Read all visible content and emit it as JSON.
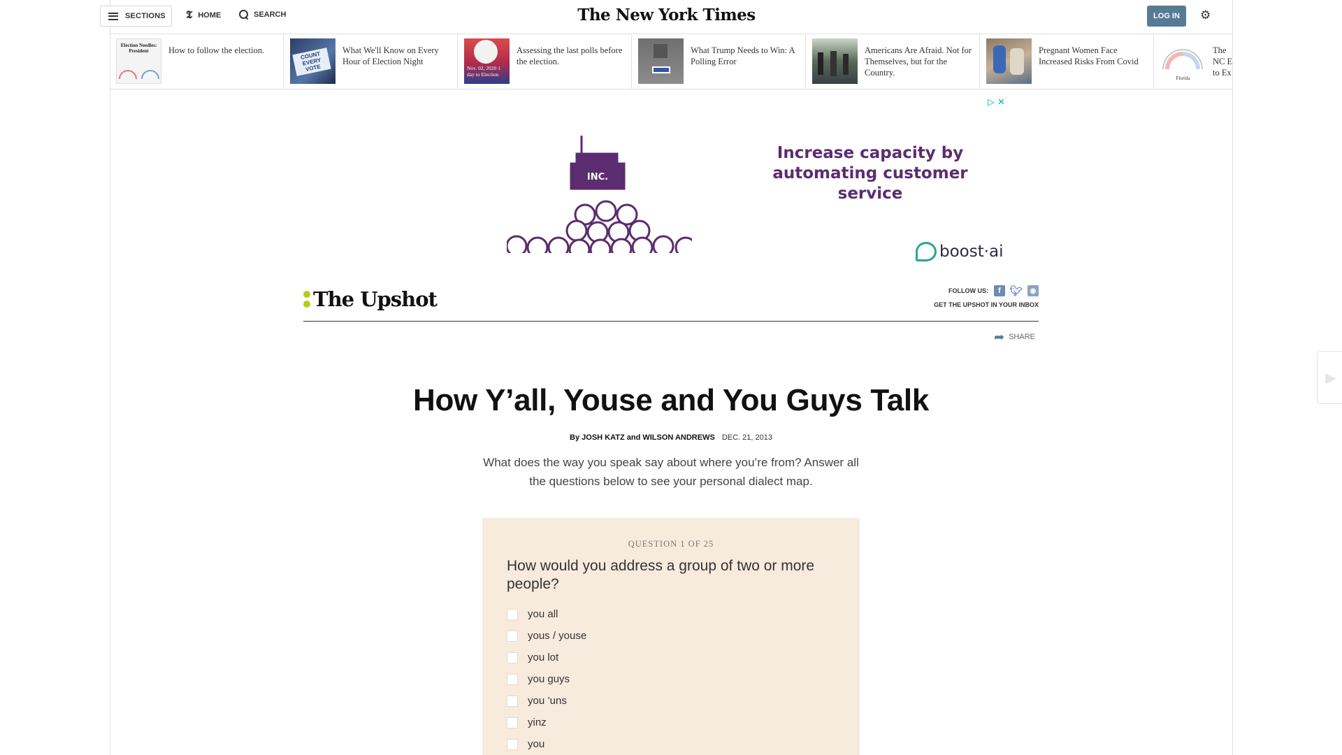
{
  "masthead": {
    "sections_label": "SECTIONS",
    "home_label": "HOME",
    "search_label": "SEARCH",
    "logo_text": "The New York Times",
    "login_label": "LOG IN"
  },
  "ribbon": [
    {
      "title": "How to follow the election.",
      "thumb_text": "Election Needles: President"
    },
    {
      "title": "What We'll Know on Every Hour of Election Night",
      "thumb_text": "COUNT EVERY VOTE"
    },
    {
      "title": "Assessing the last polls before the election.",
      "thumb_text": "Nov. 02, 2020 1 day to Election"
    },
    {
      "title": "What Trump Needs to Win: A Polling Error",
      "thumb_text": ""
    },
    {
      "title": "Americans Are Afraid. Not for Themselves, but for the Country.",
      "thumb_text": ""
    },
    {
      "title": "Pregnant Women Face Increased Risks From Covid",
      "thumb_text": ""
    },
    {
      "title": "The NC E to Ex",
      "thumb_text": "Florida"
    }
  ],
  "ad": {
    "headline": "Increase capacity by automating customer service",
    "brand": "boost·ai",
    "art_label": "INC.",
    "accent": "#5b2c6f"
  },
  "upshot": {
    "name": "The Upshot",
    "follow_label": "FOLLOW US:",
    "inbox_label": "GET THE UPSHOT IN YOUR INBOX",
    "share_label": "SHARE",
    "accent": "#b5cc18"
  },
  "article": {
    "headline": "How Y’all, Youse and You Guys Talk",
    "byline": "By JOSH KATZ and WILSON ANDREWS",
    "date": "DEC. 21, 2013",
    "dek": "What does the way you speak say about where you’re from? Answer all the questions below to see your personal dialect map."
  },
  "quiz": {
    "counter": "QUESTION 1 OF 25",
    "question": "How would you address a group of two or more people?",
    "options": [
      "you all",
      "yous / youse",
      "you lot",
      "you guys",
      "you ’uns",
      "yinz",
      "you"
    ],
    "background": "#f7ebdd"
  },
  "icons": {
    "menu": "menu-icon",
    "home": "nyt-t-icon",
    "search": "search-icon",
    "settings": "gear-icon",
    "share": "share-arrow-icon"
  }
}
